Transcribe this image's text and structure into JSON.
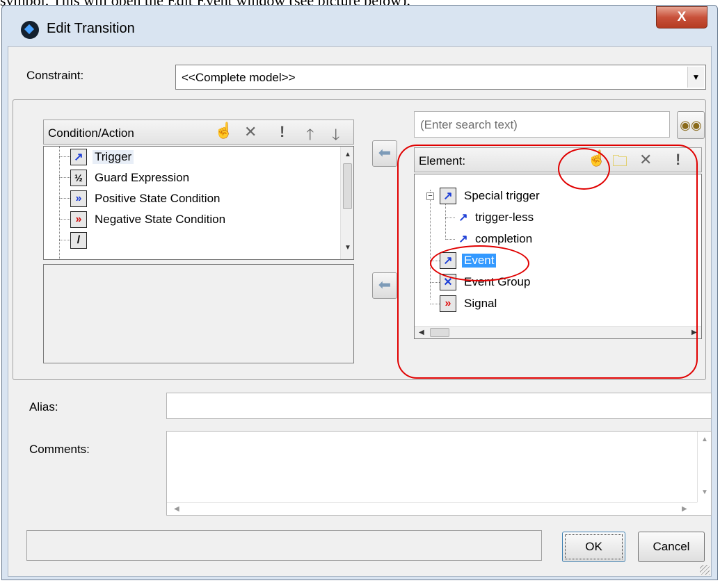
{
  "caption": "symbol. This will open the Edit Event window (see picture below).",
  "window": {
    "title": "Edit Transition",
    "close_glyph": "X"
  },
  "constraint": {
    "label": "Constraint:",
    "value": "<<Complete model>>"
  },
  "condition_pane": {
    "header": "Condition/Action",
    "items": [
      {
        "label": "Trigger",
        "icon": "trigger-arrow-icon",
        "glyph": "↗"
      },
      {
        "label": "Guard Expression",
        "icon": "guard-fraction-icon",
        "glyph": "⅟"
      },
      {
        "label": "Positive State Condition",
        "icon": "positive-state-icon",
        "glyph": "»"
      },
      {
        "label": "Negative State Condition",
        "icon": "negative-state-icon",
        "glyph": "»"
      },
      {
        "label": "",
        "icon": "action-slash-icon",
        "glyph": "/"
      }
    ],
    "toolbar": [
      "new-icon",
      "delete-icon",
      "exclamation-icon",
      "up-arrow-icon",
      "down-arrow-icon"
    ]
  },
  "search": {
    "placeholder": "(Enter search text)"
  },
  "element_pane": {
    "header": "Element:",
    "tree": [
      {
        "label": "Special trigger",
        "expander": "−"
      },
      {
        "label": "trigger-less"
      },
      {
        "label": "completion"
      },
      {
        "label": "Event",
        "selected": true
      },
      {
        "label": "Event Group"
      },
      {
        "label": "Signal"
      }
    ]
  },
  "alias": {
    "label": "Alias:",
    "value": ""
  },
  "comments": {
    "label": "Comments:",
    "value": ""
  },
  "buttons": {
    "ok": "OK",
    "cancel": "Cancel"
  },
  "colors": {
    "annotation": "#e00000",
    "selection": "#3399ff",
    "icon_blue": "#1e3fd6"
  }
}
